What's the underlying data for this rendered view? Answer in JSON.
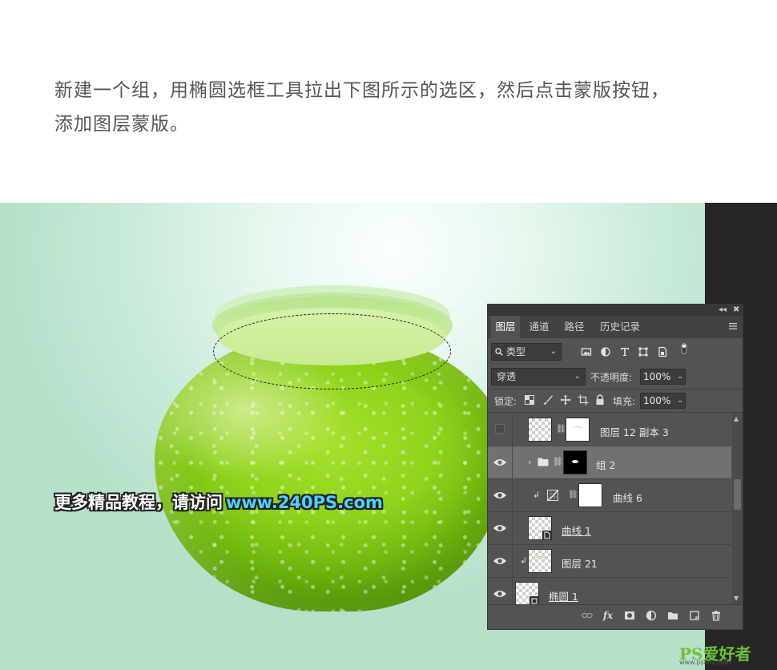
{
  "instruction": {
    "line1": "新建一个组，用椭圆选框工具拉出下图所示的选区，然后点击蒙版按钮，",
    "line2": "添加图层蒙版。"
  },
  "watermark": {
    "text": "更多精品教程，请访问",
    "url": "www.240PS.com"
  },
  "panel": {
    "collapse_glyph": "◂◂",
    "close_glyph": "✖",
    "tabs": [
      "图层",
      "通道",
      "路径",
      "历史记录"
    ],
    "active_tab": "图层",
    "filter_kind": "类型",
    "filter_icons": [
      "image-filter-icon",
      "adjustment-filter-icon",
      "type-filter-icon",
      "shape-filter-icon",
      "smart-object-filter-icon",
      "filter-toggle-icon"
    ],
    "blend_mode": "穿透",
    "opacity_label": "不透明度:",
    "opacity_value": "100%",
    "lock_label": "锁定:",
    "fill_label": "填充:",
    "fill_value": "100%",
    "layers": [
      {
        "name": "图层 12 副本 3",
        "visible": false,
        "thumb": "transparent",
        "mask": "white",
        "selected": false
      },
      {
        "name": "组 2",
        "visible": true,
        "thumb": "folder",
        "mask": "black",
        "selected": true
      },
      {
        "name": "曲线 6",
        "visible": true,
        "thumb": "curves",
        "mask": "white",
        "selected": false,
        "clipped": true
      },
      {
        "name": "曲线 1",
        "visible": true,
        "thumb": "smart",
        "selected": false,
        "underline": true
      },
      {
        "name": "图层 21",
        "visible": true,
        "thumb": "transparent",
        "selected": false,
        "clipped": true
      },
      {
        "name": "椭圆 1",
        "visible": true,
        "thumb": "shape",
        "selected": false,
        "underline": true
      }
    ],
    "bottom_icons": [
      "link-layers-icon",
      "fx-icon",
      "add-mask-icon",
      "adjustment-layer-icon",
      "new-group-icon",
      "new-layer-icon",
      "trash-icon"
    ],
    "fx_label": "fx"
  },
  "logo": {
    "text": "PS爱好者",
    "site": "www.psahz.com"
  },
  "colors": {
    "apple": "#8fd21c",
    "panel_bg": "#535353",
    "selected_row": "#717171",
    "url": "#4fd0ff"
  }
}
